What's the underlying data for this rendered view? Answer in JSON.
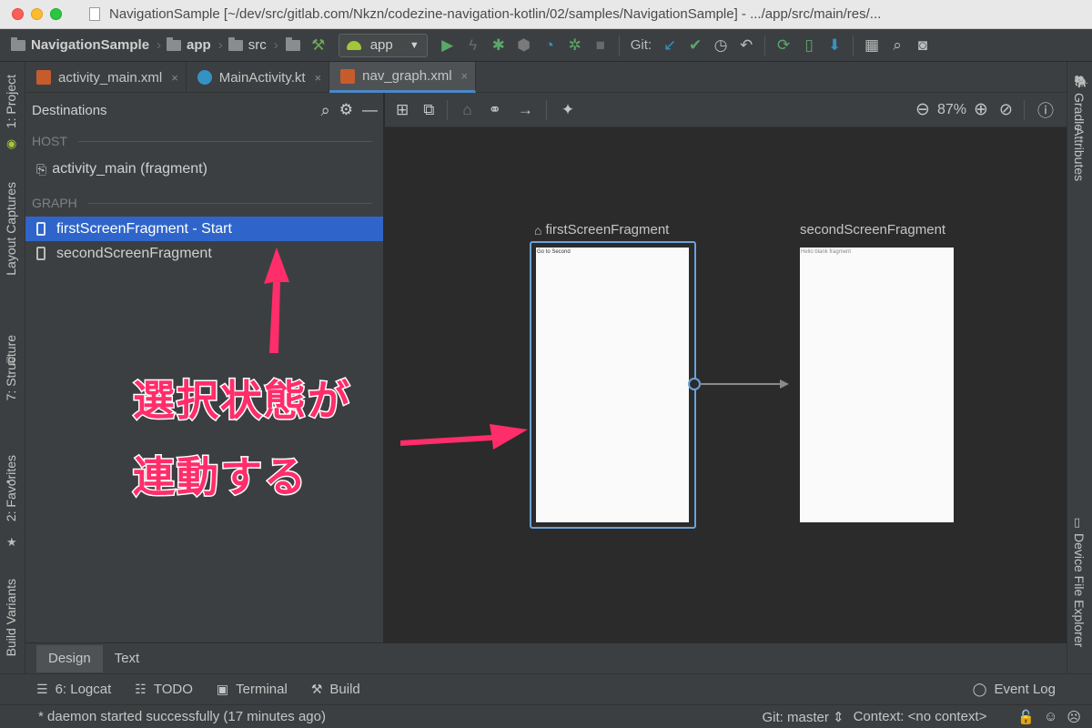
{
  "window": {
    "title": "NavigationSample [~/dev/src/gitlab.com/Nkzn/codezine-navigation-kotlin/02/samples/NavigationSample] - .../app/src/main/res/..."
  },
  "toolbar": {
    "breadcrumbs": [
      "NavigationSample",
      "app",
      "src"
    ],
    "run_config": "app",
    "git_label": "Git:"
  },
  "left_strip": {
    "project": "1: Project",
    "layout_captures": "Layout Captures",
    "structure": "7: Structure",
    "favorites": "2: Favorites",
    "build_variants": "Build Variants"
  },
  "right_strip": {
    "gradle": "Gradle",
    "attributes": "Attributes",
    "device_file_explorer": "Device File Explorer"
  },
  "tabs": [
    {
      "label": "activity_main.xml",
      "close": "×"
    },
    {
      "label": "MainActivity.kt",
      "close": "×"
    },
    {
      "label": "nav_graph.xml",
      "close": "×"
    }
  ],
  "destinations": {
    "title": "Destinations",
    "host_section": "HOST",
    "host_item": "activity_main (fragment)",
    "graph_section": "GRAPH",
    "items": [
      {
        "label": "firstScreenFragment - Start",
        "selected": true
      },
      {
        "label": "secondScreenFragment",
        "selected": false
      }
    ]
  },
  "canvas": {
    "zoom": "87%",
    "first_fragment": {
      "label": "firstScreenFragment",
      "content": "Go to Second"
    },
    "second_fragment": {
      "label": "secondScreenFragment",
      "content": "Hello blank fragment"
    }
  },
  "annotation": {
    "line1": "選択状態が",
    "line2": "連動する",
    "color": "#ff2d6a"
  },
  "bottom_tabs": [
    {
      "label": "Design",
      "active": true
    },
    {
      "label": "Text",
      "active": false
    }
  ],
  "tool_windows": {
    "logcat": "6: Logcat",
    "todo": "TODO",
    "terminal": "Terminal",
    "build": "Build",
    "event_log": "Event Log"
  },
  "status": {
    "message": "* daemon started successfully (17 minutes ago)",
    "git_branch": "Git: master ⇕",
    "context": "Context: <no context>"
  },
  "colors": {
    "selection": "#2f65ca",
    "accent_tab": "#4a88c7",
    "fragment_border": "#6aa2d8"
  }
}
